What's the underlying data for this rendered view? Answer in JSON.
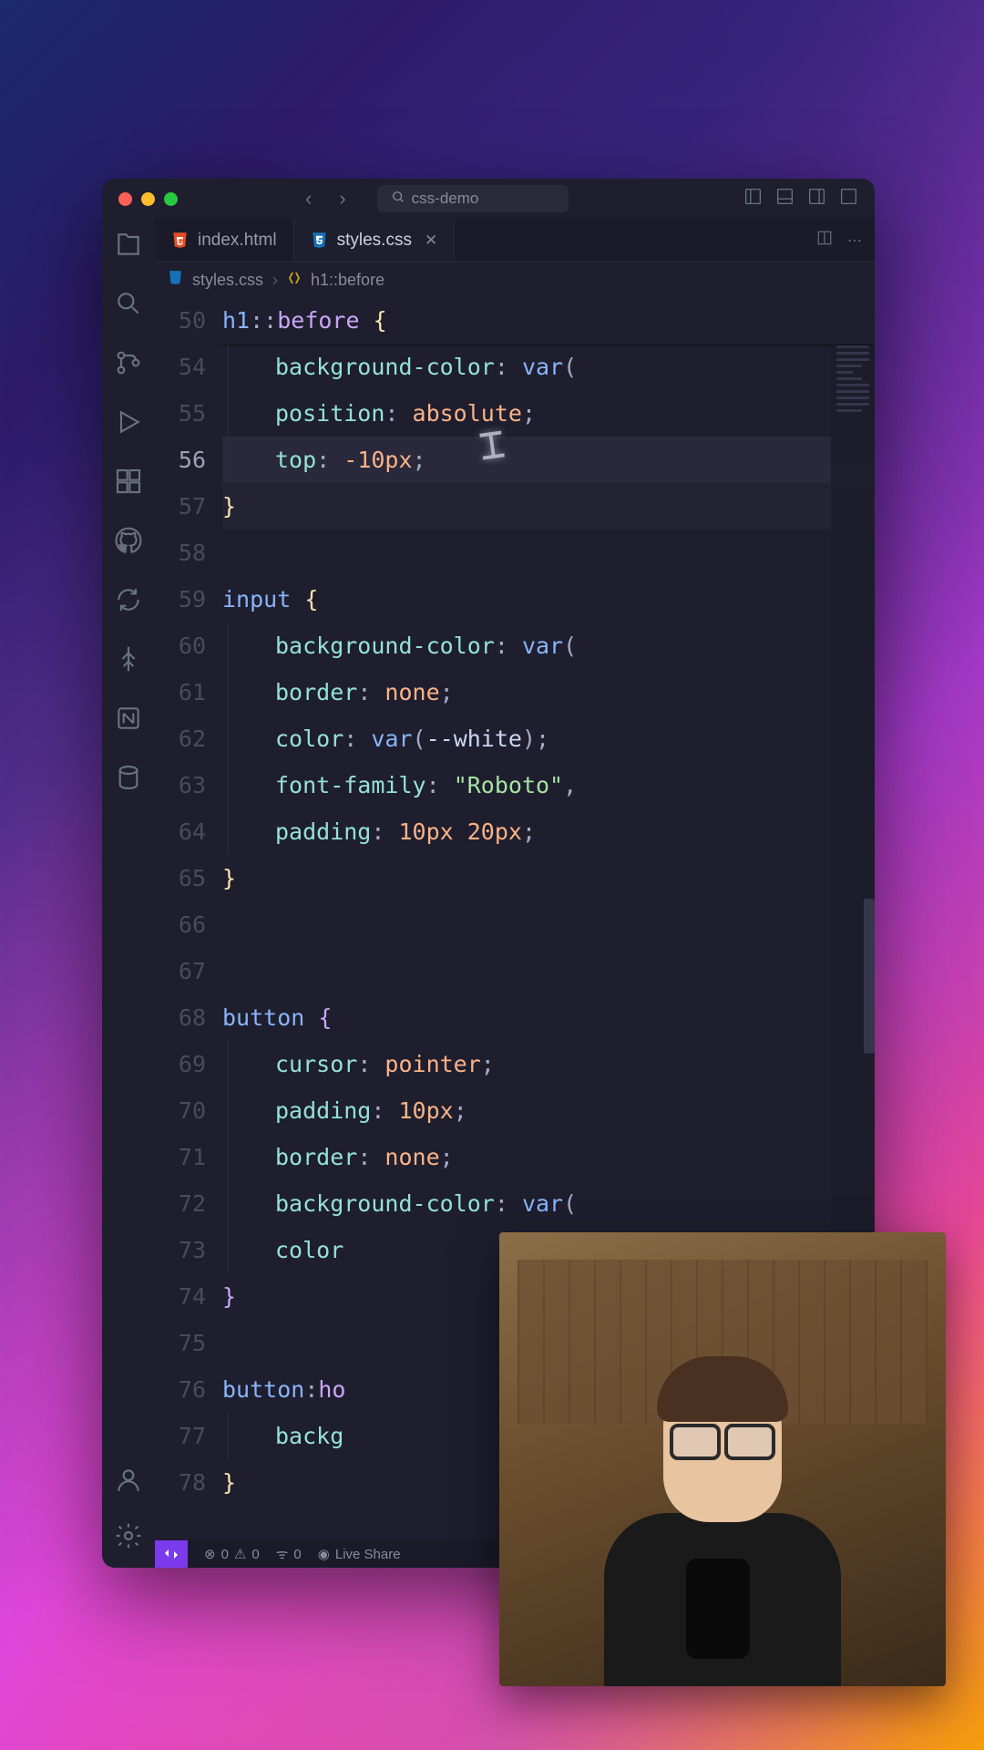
{
  "titlebar": {
    "search_text": "css-demo"
  },
  "tabs": [
    {
      "icon": "html5",
      "label": "index.html",
      "active": false
    },
    {
      "icon": "css3",
      "label": "styles.css",
      "active": true
    }
  ],
  "breadcrumb": {
    "file": "styles.css",
    "symbol": "h1::before"
  },
  "code": {
    "sticky_line": 50,
    "lines": [
      {
        "num": 50,
        "sticky": true,
        "tokens": [
          [
            "h1",
            "sel"
          ],
          [
            "::",
            "punc"
          ],
          [
            "before",
            "pseudo"
          ],
          [
            " ",
            ""
          ],
          [
            "{",
            "brace"
          ]
        ]
      },
      {
        "num": 54,
        "indent": 1,
        "tokens": [
          [
            "background-color",
            "prop"
          ],
          [
            ": ",
            "punc"
          ],
          [
            "var",
            "func"
          ],
          [
            "(",
            "punc"
          ]
        ]
      },
      {
        "num": 55,
        "indent": 1,
        "tokens": [
          [
            "position",
            "prop"
          ],
          [
            ": ",
            "punc"
          ],
          [
            "absolute",
            "val"
          ],
          [
            ";",
            "punc"
          ]
        ]
      },
      {
        "num": 56,
        "indent": 1,
        "hl": true,
        "tokens": [
          [
            "top",
            "prop"
          ],
          [
            ": ",
            "punc"
          ],
          [
            "-10px",
            "num"
          ],
          [
            ";",
            "punc"
          ]
        ]
      },
      {
        "num": 57,
        "tokens": [
          [
            "}",
            "brace"
          ]
        ],
        "brace_hl": true
      },
      {
        "num": 58,
        "tokens": []
      },
      {
        "num": 59,
        "tokens": [
          [
            "input",
            "sel"
          ],
          [
            " ",
            ""
          ],
          [
            "{",
            "brace"
          ]
        ]
      },
      {
        "num": 60,
        "indent": 1,
        "tokens": [
          [
            "background-color",
            "prop"
          ],
          [
            ": ",
            "punc"
          ],
          [
            "var",
            "func"
          ],
          [
            "(",
            "punc"
          ]
        ]
      },
      {
        "num": 61,
        "indent": 1,
        "tokens": [
          [
            "border",
            "prop"
          ],
          [
            ": ",
            "punc"
          ],
          [
            "none",
            "none"
          ],
          [
            ";",
            "punc"
          ]
        ]
      },
      {
        "num": 62,
        "indent": 1,
        "tokens": [
          [
            "color",
            "prop"
          ],
          [
            ": ",
            "punc"
          ],
          [
            "var",
            "func"
          ],
          [
            "(",
            "punc"
          ],
          [
            "--white",
            "var"
          ],
          [
            ")",
            "punc"
          ],
          [
            ";",
            "punc"
          ]
        ]
      },
      {
        "num": 63,
        "indent": 1,
        "tokens": [
          [
            "font-family",
            "prop"
          ],
          [
            ": ",
            "punc"
          ],
          [
            "\"Roboto\"",
            "str"
          ],
          [
            ",",
            "punc"
          ]
        ]
      },
      {
        "num": 64,
        "indent": 1,
        "tokens": [
          [
            "padding",
            "prop"
          ],
          [
            ": ",
            "punc"
          ],
          [
            "10px",
            "num"
          ],
          [
            " ",
            ""
          ],
          [
            "20px",
            "num"
          ],
          [
            ";",
            "punc"
          ]
        ]
      },
      {
        "num": 65,
        "tokens": [
          [
            "}",
            "brace"
          ]
        ]
      },
      {
        "num": 66,
        "tokens": []
      },
      {
        "num": 67,
        "tokens": []
      },
      {
        "num": 68,
        "tokens": [
          [
            "button",
            "sel"
          ],
          [
            " ",
            ""
          ],
          [
            "{",
            "brace2"
          ]
        ]
      },
      {
        "num": 69,
        "indent": 1,
        "tokens": [
          [
            "cursor",
            "prop"
          ],
          [
            ": ",
            "punc"
          ],
          [
            "pointer",
            "val"
          ],
          [
            ";",
            "punc"
          ]
        ]
      },
      {
        "num": 70,
        "indent": 1,
        "tokens": [
          [
            "padding",
            "prop"
          ],
          [
            ": ",
            "punc"
          ],
          [
            "10px",
            "num"
          ],
          [
            ";",
            "punc"
          ]
        ]
      },
      {
        "num": 71,
        "indent": 1,
        "tokens": [
          [
            "border",
            "prop"
          ],
          [
            ": ",
            "punc"
          ],
          [
            "none",
            "none"
          ],
          [
            ";",
            "punc"
          ]
        ]
      },
      {
        "num": 72,
        "indent": 1,
        "tokens": [
          [
            "background-color",
            "prop"
          ],
          [
            ": ",
            "punc"
          ],
          [
            "var",
            "func"
          ],
          [
            "(",
            "punc"
          ]
        ]
      },
      {
        "num": 73,
        "indent": 1,
        "tokens": [
          [
            "color",
            "prop"
          ]
        ]
      },
      {
        "num": 74,
        "tokens": [
          [
            "}",
            "brace2"
          ]
        ]
      },
      {
        "num": 75,
        "tokens": []
      },
      {
        "num": 76,
        "tokens": [
          [
            "button",
            "sel"
          ],
          [
            ":",
            "punc"
          ],
          [
            "ho",
            "pseudo"
          ]
        ]
      },
      {
        "num": 77,
        "indent": 1,
        "tokens": [
          [
            "backg",
            "prop"
          ]
        ]
      },
      {
        "num": 78,
        "tokens": [
          [
            "}",
            "brace"
          ]
        ]
      }
    ]
  },
  "statusbar": {
    "errors": "0",
    "warnings": "0",
    "ports": "0",
    "live_share": "Live Share"
  }
}
